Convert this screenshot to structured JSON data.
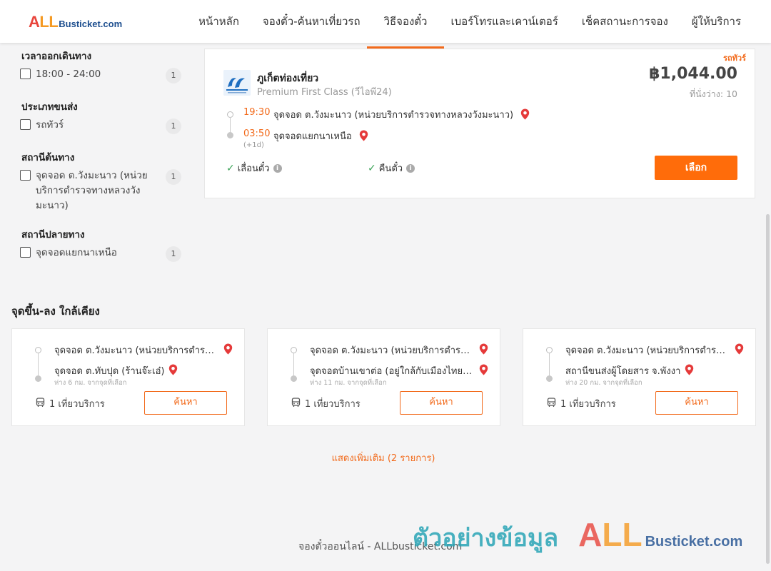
{
  "logo": {
    "all_a": "A",
    "all_l": "LL",
    "rest": "Busticket.com"
  },
  "nav": [
    "หน้าหลัก",
    "จองตั๋ว-ค้นหาเที่ยวรถ",
    "วิธีจองตั๋ว",
    "เบอร์โทรและเคาน์เตอร์",
    "เช็คสถานะการจอง",
    "ผู้ให้บริการ"
  ],
  "filters": {
    "departure_time": {
      "title": "เวลาออกเดินทาง",
      "options": [
        {
          "label": "18:00 - 24:00",
          "count": "1"
        }
      ]
    },
    "vehicle_type": {
      "title": "ประเภทขนส่ง",
      "options": [
        {
          "label": "รถทัวร์",
          "count": "1"
        }
      ]
    },
    "origin_station": {
      "title": "สถานีต้นทาง",
      "options": [
        {
          "label": "จุดจอด ต.วังมะนาว (หน่วยบริการตำรวจทางหลวงวังมะนาว)",
          "count": "1"
        }
      ]
    },
    "destination_station": {
      "title": "สถานีปลายทาง",
      "options": [
        {
          "label": "จุดจอดแยกนาเหนือ",
          "count": "1"
        }
      ]
    }
  },
  "trip": {
    "tag": "รถทัวร์",
    "operator_name": "ภูเก็ตท่องเที่ยว",
    "operator_class": "Premium First Class (วีไอพี24)",
    "price": "฿1,044.00",
    "seats": "ที่นั่งว่าง: 10",
    "depart_time": "19:30",
    "depart_stop": "จุดจอด ต.วังมะนาว (หน่วยบริการตำรวจทางหลวงวังมะนาว)",
    "arrive_time": "03:50",
    "arrive_stop": "จุดจอดแยกนาเหนือ",
    "next_day": "(+1d)",
    "policy_reschedule": "เลื่อนตั๋ว",
    "policy_refund": "คืนตั๋ว",
    "select_label": "เลือก"
  },
  "nearby": {
    "title": "จุดขึ้น-ลง ใกล้เคียง",
    "cards": [
      {
        "from": "จุดจอด ต.วังมะนาว (หน่วยบริการตำรวจทางหลวงวังมะนาว)",
        "to": "จุดจอด ต.ทับปุด (ร้านจ๊ะเอ๋)",
        "distance": "ห่าง 6 กม. จากจุดที่เลือก",
        "trips": "1 เที่ยวบริการ",
        "search_label": "ค้นหา"
      },
      {
        "from": "จุดจอด ต.วังมะนาว (หน่วยบริการตำรวจทางหลวงวังมะนาว)",
        "to": "จุดจอดบ้านเขาต่อ (อยู่ใกล้กับเมืองไทยประกันภัย)",
        "distance": "ห่าง 11 กม. จากจุดที่เลือก",
        "trips": "1 เที่ยวบริการ",
        "search_label": "ค้นหา"
      },
      {
        "from": "จุดจอด ต.วังมะนาว (หน่วยบริการตำรวจทางหลวงวังมะนาว)",
        "to": "สถานีขนส่งผู้โดยสาร จ.พังงา",
        "distance": "ห่าง 20 กม. จากจุดที่เลือก",
        "trips": "1 เที่ยวบริการ",
        "search_label": "ค้นหา"
      }
    ],
    "show_more": "แสดงเพิ่มเติม (2 รายการ)"
  },
  "footer": {
    "text": "จองตั๋วออนไลน์ - ALLbusticket.com"
  },
  "watermark": {
    "thai": "ตัวอย่างข้อมูล",
    "all_a": "A",
    "all_l": "LL",
    "rest": "Busticket.com"
  },
  "colors": {
    "accent": "#ff6c0a",
    "brand_red": "#e8453c",
    "brand_orange": "#f59a23",
    "brand_blue": "#1e4f8f"
  }
}
